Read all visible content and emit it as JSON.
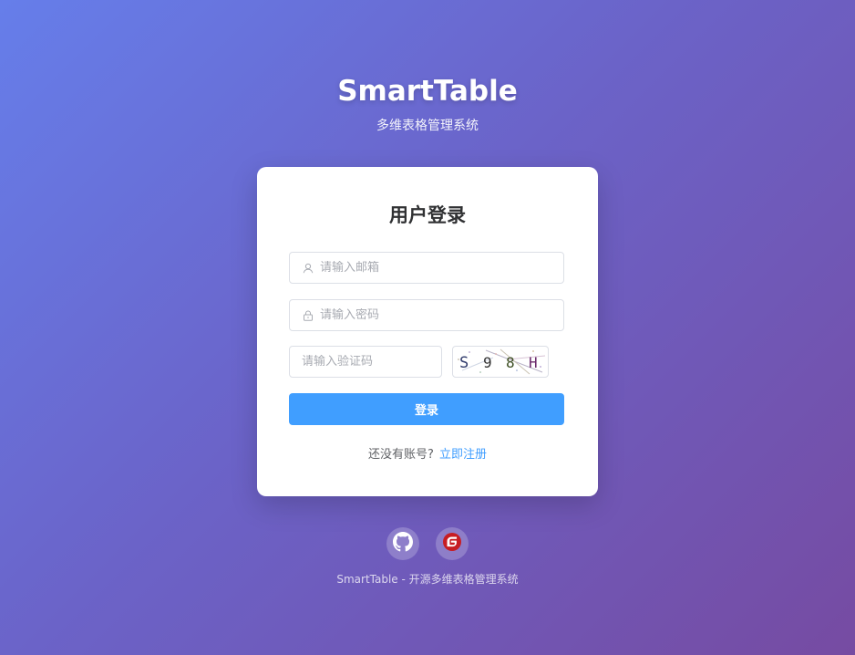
{
  "brand": {
    "title": "SmartTable",
    "subtitle": "多维表格管理系统"
  },
  "login": {
    "title": "用户登录",
    "email": {
      "placeholder": "请输入邮箱",
      "icon": "user-icon"
    },
    "password": {
      "placeholder": "请输入密码",
      "icon": "lock-icon"
    },
    "captcha": {
      "placeholder": "请输入验证码",
      "code": [
        "S",
        "9",
        "8",
        "H"
      ]
    },
    "submit_label": "登录",
    "register_prompt": "还没有账号?",
    "register_link": "立即注册"
  },
  "social": [
    {
      "name": "github",
      "icon": "github-icon"
    },
    {
      "name": "gitee",
      "icon": "gitee-icon"
    }
  ],
  "footer": {
    "text": "SmartTable - 开源多维表格管理系统"
  },
  "colors": {
    "primary": "#409eff",
    "background_start": "#667eea",
    "background_end": "#764ba2",
    "gitee": "#c71d23"
  }
}
